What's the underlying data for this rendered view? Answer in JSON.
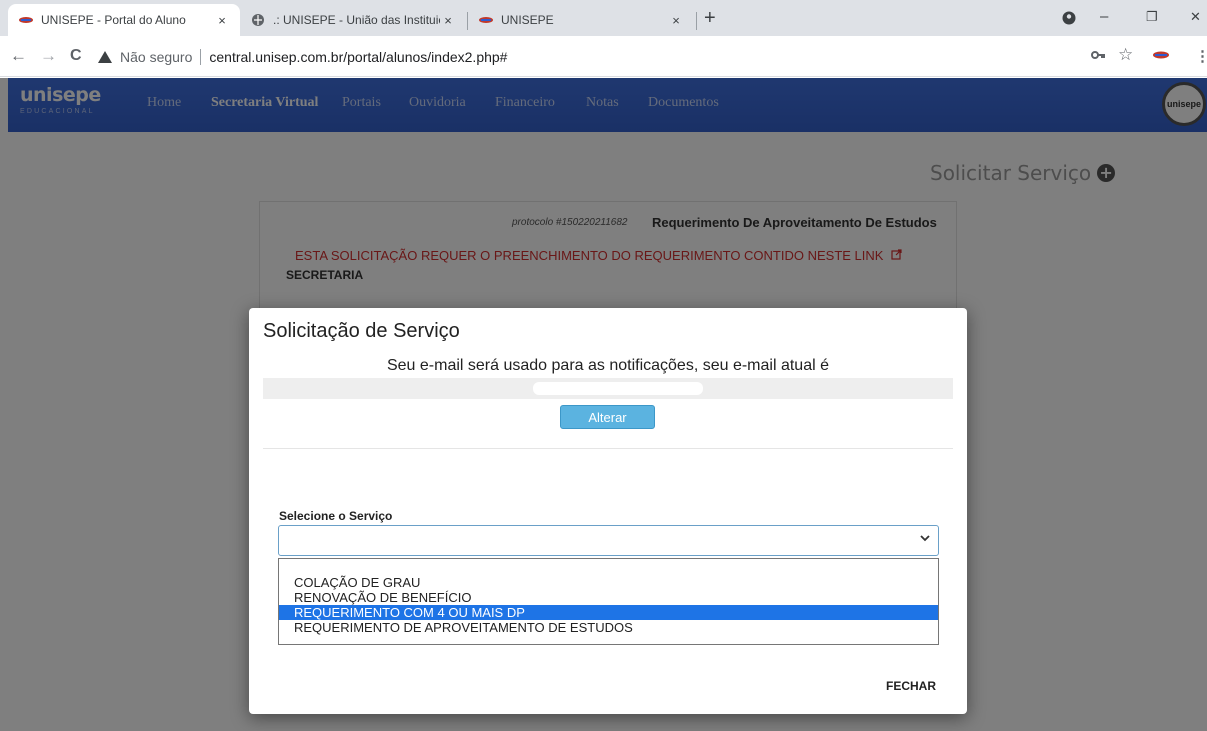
{
  "browser": {
    "tabs": [
      {
        "title": "UNISEPE - Portal do Aluno",
        "close": "×"
      },
      {
        "title": ".: UNISEPE - União das Instituiçõ",
        "close": "×"
      },
      {
        "title": "UNISEPE",
        "close": "×"
      }
    ],
    "new_tab": "+",
    "window_controls": {
      "minimize": "–",
      "restore": "❐",
      "close": "✕"
    },
    "nav": {
      "back": "←",
      "forward": "→",
      "reload": "C"
    },
    "security_label": "Não seguro",
    "url": "central.unisep.com.br/portal/alunos/index2.php#"
  },
  "site": {
    "logo": "unisepe",
    "logo_sub": "EDUCACIONAL",
    "menu": [
      "Home",
      "Secretaria Virtual",
      "Portais",
      "Ouvidoria",
      "Financeiro",
      "Notas",
      "Documentos"
    ],
    "active_menu": "Secretaria Virtual",
    "badge": "unisepe"
  },
  "page": {
    "solicitar_label": "Solicitar Serviço",
    "protocol_number": "protocolo #150220211682",
    "protocol_title": "Requerimento De Aproveitamento De Estudos",
    "protocol_link": "ESTA SOLICITAÇÃO REQUER O PREENCHIMENTO DO REQUERIMENTO CONTIDO NESTE LINK",
    "protocol_dept": "SECRETARIA"
  },
  "modal": {
    "title": "Solicitação de Serviço",
    "email_info": "Seu e-mail será usado para as notificações, seu e-mail atual é",
    "alterar_label": "Alterar",
    "select_label": "Selecione o Serviço",
    "select_value": "",
    "options": [
      "COLAÇÃO DE GRAU",
      "RENOVAÇÃO DE BENEFÍCIO",
      "REQUERIMENTO COM 4 OU MAIS DP",
      "REQUERIMENTO DE APROVEITAMENTO DE ESTUDOS"
    ],
    "highlighted_option": "REQUERIMENTO COM 4 OU MAIS DP",
    "close_label": "FECHAR"
  },
  "colors": {
    "nav_blue": "#3a68d6",
    "link_red": "#d32f2f",
    "button_blue": "#5bb3e0",
    "option_highlight": "#1e74e6"
  }
}
